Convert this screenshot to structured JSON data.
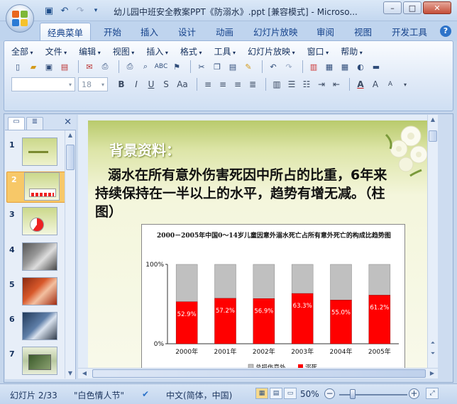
{
  "window": {
    "title": "幼儿园中班安全教案PPT《防溺水》.ppt [兼容模式] - Microso...",
    "controls": {
      "minimize": "–",
      "restore": "□",
      "close": "✕"
    }
  },
  "quick_access": {
    "save": "save-icon",
    "undo": "↶",
    "redo": "↷",
    "customize": "▾"
  },
  "ribbon_tabs": [
    "经典菜单",
    "开始",
    "插入",
    "设计",
    "动画",
    "幻灯片放映",
    "审阅",
    "视图",
    "开发工具"
  ],
  "active_tab": "经典菜单",
  "menu_bar": [
    "全部",
    "文件",
    "编辑",
    "视图",
    "插入",
    "格式",
    "工具",
    "幻灯片放映",
    "窗口",
    "帮助"
  ],
  "font_size": "18",
  "font_name": "",
  "slide": {
    "heading": "背景资料：",
    "body": "溺水在所有意外伤害死因中所占的比重，6年来持续保持在一半以上的水平，趋势有增无减。（柱图）"
  },
  "chart_data": {
    "type": "bar",
    "title": "2000－2005年中国0～14岁儿童因意外溺水死亡占所有意外死亡的构成比趋势图",
    "categories": [
      "2000年",
      "2001年",
      "2002年",
      "2003年",
      "2004年",
      "2005年"
    ],
    "series": [
      {
        "name": "溺死",
        "color": "#ff0000",
        "values": [
          52.9,
          57.2,
          56.9,
          63.3,
          55.0,
          61.2
        ]
      },
      {
        "name": "总损伤意外",
        "color": "#c0c0c0",
        "values": [
          47.1,
          42.8,
          43.1,
          36.7,
          45.0,
          38.8
        ]
      }
    ],
    "value_labels": [
      "52.9%",
      "57.2%",
      "56.9%",
      "63.3%",
      "55.0%",
      "61.2%"
    ],
    "y_ticks": [
      "100%",
      "0%"
    ],
    "ylim": [
      0,
      100
    ],
    "stacked": true,
    "legend": "bottom",
    "grid": false
  },
  "thumbnails": [
    {
      "num": "1"
    },
    {
      "num": "2"
    },
    {
      "num": "3"
    },
    {
      "num": "4"
    },
    {
      "num": "5"
    },
    {
      "num": "6"
    },
    {
      "num": "7"
    }
  ],
  "selected_thumbnail": "2",
  "status": {
    "slide_info": "幻灯片 2/33",
    "theme": "\"白色情人节\"",
    "language": "中文(简体，中国)",
    "zoom": "50%",
    "zoom_minus": "−",
    "zoom_plus": "+"
  }
}
